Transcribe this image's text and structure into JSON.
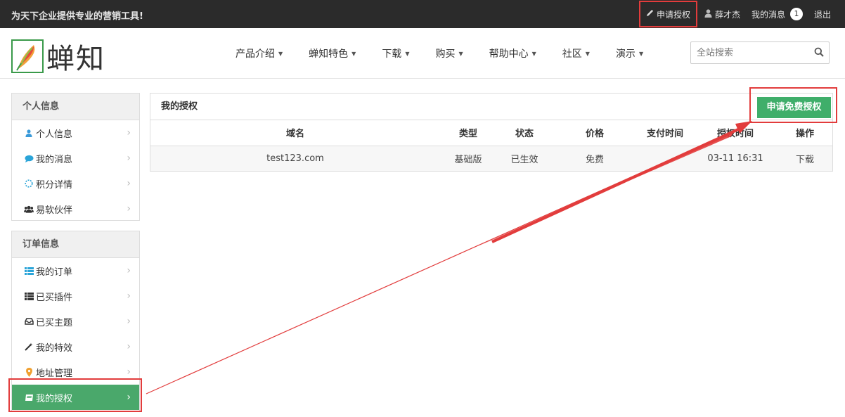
{
  "topbar": {
    "slogan": "为天下企业提供专业的营销工具!",
    "apply_license": "申请授权",
    "username": "薛才杰",
    "my_messages": "我的消息",
    "message_count": "1",
    "logout": "退出"
  },
  "header": {
    "logo_text": "蝉知",
    "nav": [
      {
        "label": "产品介绍"
      },
      {
        "label": "蝉知特色"
      },
      {
        "label": "下载"
      },
      {
        "label": "购买"
      },
      {
        "label": "帮助中心"
      },
      {
        "label": "社区"
      },
      {
        "label": "演示"
      }
    ],
    "search_placeholder": "全站搜索"
  },
  "sidebar": {
    "personal": {
      "title": "个人信息",
      "items": [
        {
          "label": "个人信息",
          "icon": "user-icon"
        },
        {
          "label": "我的消息",
          "icon": "comment-icon"
        },
        {
          "label": "积分详情",
          "icon": "spinner-icon"
        },
        {
          "label": "易软伙伴",
          "icon": "group-icon"
        }
      ]
    },
    "orders": {
      "title": "订单信息",
      "items": [
        {
          "label": "我的订单",
          "icon": "list-icon"
        },
        {
          "label": "已买插件",
          "icon": "list-icon"
        },
        {
          "label": "已买主题",
          "icon": "inbox-icon"
        },
        {
          "label": "我的特效",
          "icon": "magic-icon"
        },
        {
          "label": "地址管理",
          "icon": "map-marker-icon"
        },
        {
          "label": "我的授权",
          "icon": "book-icon",
          "active": true
        }
      ]
    }
  },
  "main": {
    "title": "我的授权",
    "apply_free_button": "申请免费授权",
    "columns": [
      "域名",
      "类型",
      "状态",
      "价格",
      "支付时间",
      "授权时间",
      "操作"
    ],
    "rows": [
      {
        "domain": "test123.com",
        "type": "基础版",
        "status": "已生效",
        "price": "免费",
        "pay_time": "",
        "license_time": "03-11 16:31",
        "action": "下载"
      }
    ]
  },
  "colors": {
    "accent_green": "#3fae6a",
    "highlight_red": "#e23c3c",
    "topbar_bg": "#2b2b2b"
  }
}
